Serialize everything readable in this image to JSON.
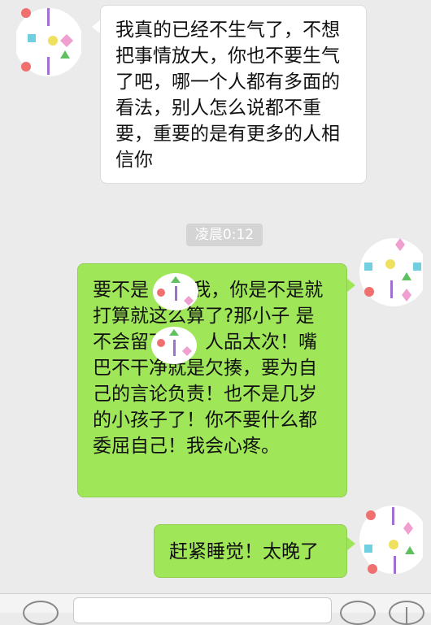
{
  "messages": [
    {
      "side": "in",
      "text": "我真的已经不生气了，不想把事情放大，你也不要生气了吧，哪一个人都有多面的看法，别人怎么说都不重要，重要的是有更多的人相信你"
    },
    {
      "side": "out",
      "text": "要不是      告诉我，你是不是就打算就这么算了?那小子      是不会留下了，人品太次！嘴巴不干净就是欠揍，要为自己的言论负责！也不是几岁的小孩子了！你不要什么都委屈自己！我会心疼。"
    },
    {
      "side": "out",
      "text": "赶紧睡觉！太晚了"
    }
  ],
  "timestamp": "凌晨0:12",
  "icons": {
    "avatar_left": "patterned-avatar-icon",
    "avatar_right": "patterned-avatar-icon",
    "voice": "voice-icon",
    "emoji": "emoji-icon",
    "plus": "plus-icon"
  },
  "colors": {
    "background": "#ebebeb",
    "incoming_bubble": "#ffffff",
    "outgoing_bubble": "#9fe658",
    "timestamp_pill": "#d4d4d4"
  }
}
